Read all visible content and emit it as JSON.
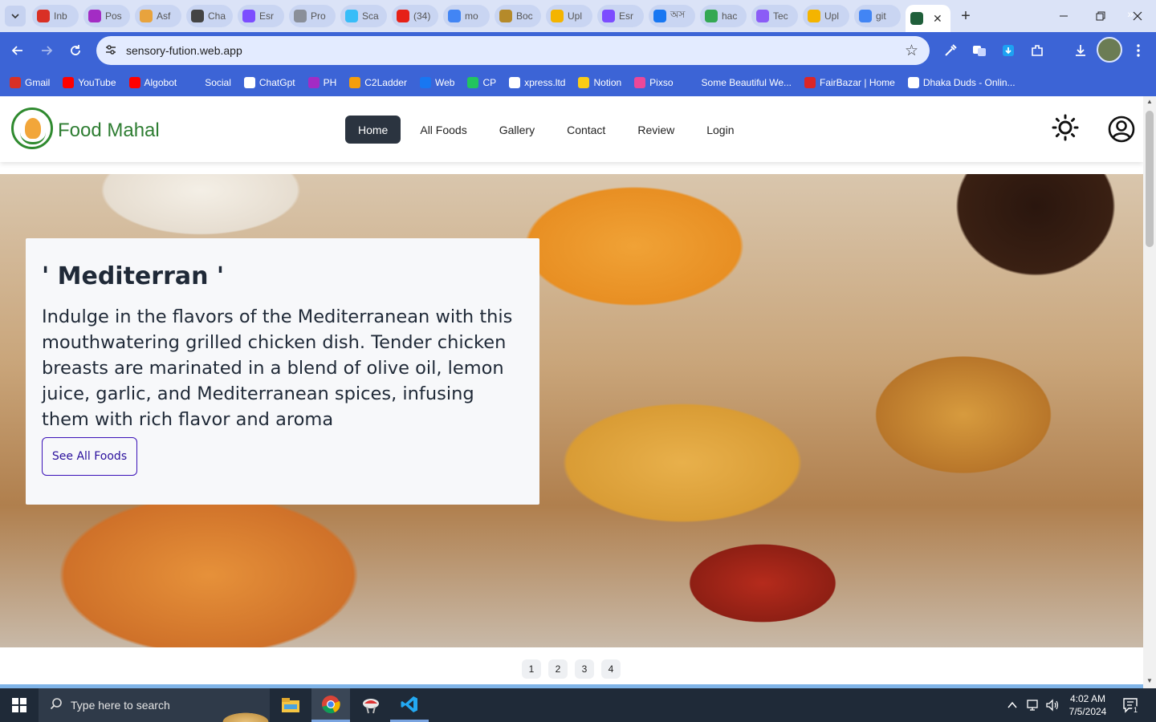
{
  "browser": {
    "tabs": [
      {
        "title": "Inb",
        "icon": "gmail-icon",
        "color": "#d93025"
      },
      {
        "title": "Pos",
        "icon": "pos-icon",
        "color": "#a32cc4"
      },
      {
        "title": "Asf",
        "icon": "figma-star-icon",
        "color": "#e8a33d"
      },
      {
        "title": "Cha",
        "icon": "chatgpt-icon",
        "color": "#444444"
      },
      {
        "title": "Esr",
        "icon": "v-icon",
        "color": "#7c4dff"
      },
      {
        "title": "Pro",
        "icon": "globe-icon",
        "color": "#8a8f99"
      },
      {
        "title": "Sca",
        "icon": "tailwind-icon",
        "color": "#38bdf8"
      },
      {
        "title": "(34)",
        "icon": "youtube-icon",
        "color": "#e62117"
      },
      {
        "title": "mo",
        "icon": "google-icon",
        "color": "#4285f4"
      },
      {
        "title": "Boc",
        "icon": "home-icon",
        "color": "#b58a2a"
      },
      {
        "title": "Upl",
        "icon": "layers-icon",
        "color": "#f4b400"
      },
      {
        "title": "Esr",
        "icon": "v-icon",
        "color": "#7c4dff"
      },
      {
        "title": "অস",
        "icon": "facebook-icon",
        "color": "#1877f2"
      },
      {
        "title": "hac",
        "icon": "drive-icon",
        "color": "#34a853"
      },
      {
        "title": "Tec",
        "icon": "pen-icon",
        "color": "#8b5cf6"
      },
      {
        "title": "Upl",
        "icon": "layers-icon",
        "color": "#f4b400"
      },
      {
        "title": "git",
        "icon": "google-icon",
        "color": "#4285f4"
      },
      {
        "title": "",
        "icon": "app-icon",
        "color": "#1f5f3a",
        "active": true
      }
    ],
    "url": "sensory-fution.web.app",
    "bookmarks": [
      {
        "label": "Gmail",
        "icon": "gmail-icon",
        "color": "#d93025"
      },
      {
        "label": "YouTube",
        "icon": "youtube-icon",
        "color": "#ff0000"
      },
      {
        "label": "Algobot",
        "icon": "youtube-icon",
        "color": "#ff0000"
      },
      {
        "label": "Social",
        "icon": "folder-icon",
        "color": "#3c64d6"
      },
      {
        "label": "ChatGpt",
        "icon": "chatgpt-icon",
        "color": "#ffffff"
      },
      {
        "label": "PH",
        "icon": "ph-icon",
        "color": "#a32cc4"
      },
      {
        "label": "C2Ladder",
        "icon": "ladder-icon",
        "color": "#f59e0b"
      },
      {
        "label": "Web",
        "icon": "facebook-icon",
        "color": "#1877f2"
      },
      {
        "label": "CP",
        "icon": "cp-icon",
        "color": "#22c55e"
      },
      {
        "label": "xpress.ltd",
        "icon": "page-icon",
        "color": "#ffffff"
      },
      {
        "label": "Notion",
        "icon": "notion-icon",
        "color": "#facc15"
      },
      {
        "label": "Pixso",
        "icon": "pixso-icon",
        "color": "#ec4899"
      },
      {
        "label": "Some Beautiful We...",
        "icon": "folder-icon",
        "color": "#3c64d6"
      },
      {
        "label": "FairBazar | Home",
        "icon": "fairbazar-icon",
        "color": "#dc2626"
      },
      {
        "label": "Dhaka Duds - Onlin...",
        "icon": "dhakaduds-icon",
        "color": "#ffffff"
      }
    ]
  },
  "site": {
    "brand": "Food Mahal",
    "nav": [
      "Home",
      "All Foods",
      "Gallery",
      "Contact",
      "Review",
      "Login"
    ],
    "active_nav": "Home",
    "hero": {
      "title": "' Mediterran '",
      "description": "Indulge in the flavors of the Mediterranean with this mouthwatering grilled chicken dish. Tender chicken breasts are marinated in a blend of olive oil, lemon juice, garlic, and Mediterranean spices, infusing them with rich flavor and aroma",
      "cta": "See All Foods"
    },
    "slides": [
      "1",
      "2",
      "3",
      "4"
    ]
  },
  "taskbar": {
    "search_placeholder": "Type here to search",
    "time": "4:02 AM",
    "date": "7/5/2024",
    "notification_count": "1"
  }
}
